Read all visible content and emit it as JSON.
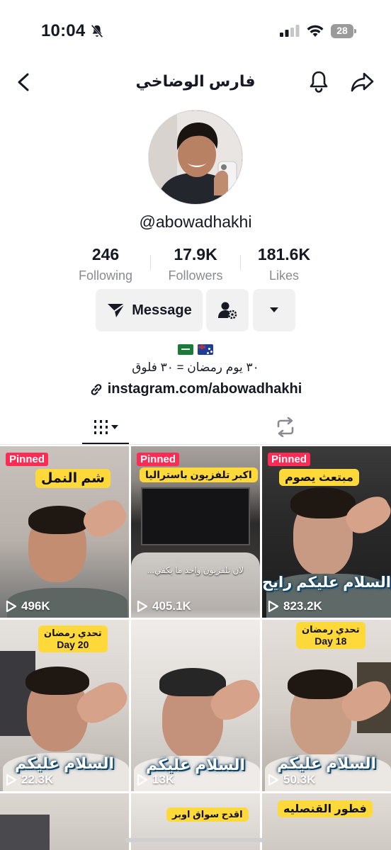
{
  "status_bar": {
    "time": "10:04",
    "battery": "28"
  },
  "header": {
    "title": "فارس الوضاخي"
  },
  "profile": {
    "username": "@abowadhakhi",
    "stats": [
      {
        "value": "246",
        "label": "Following"
      },
      {
        "value": "17.9K",
        "label": "Followers"
      },
      {
        "value": "181.6K",
        "label": "Likes"
      }
    ],
    "message_label": "Message",
    "bio_flags": [
      "saudi-flag",
      "australia-flag"
    ],
    "bio": "٣٠ يوم رمضان = ٣٠ فلوق",
    "link": "instagram.com/abowadhakhi"
  },
  "icons": {
    "back": "chevron-left-icon",
    "bell": "bell-icon",
    "share": "share-icon",
    "message": "send-icon",
    "suggest": "add-friend-gear-icon",
    "more": "triangle-down-icon",
    "link": "link-icon",
    "videos_tab": "grid-icon",
    "reposts_tab": "repost-icon",
    "play": "play-icon"
  },
  "colors": {
    "pinned_badge": "#fe2c55",
    "caption_bg": "#ffd83a",
    "button_bg": "#f1f1f2",
    "secondary_text": "#8a8b91"
  },
  "videos": [
    {
      "pinned": "Pinned",
      "caption": "شم النمل",
      "overlay": "",
      "views": "496K"
    },
    {
      "pinned": "Pinned",
      "caption": "اكبر تلفزيون باستراليا",
      "overlay": "لان تلفزيون واحد ما يكفي...",
      "views": "405.1K"
    },
    {
      "pinned": "Pinned",
      "caption": "مبتعث يصوم",
      "overlay": "السلام عليكم رايح",
      "views": "823.2K"
    },
    {
      "pinned": "",
      "caption": "تحدي رمضان",
      "caption_sub": "Day 20",
      "overlay": "السلام عليكم",
      "views": "22.3K"
    },
    {
      "pinned": "",
      "caption": "",
      "overlay": "السلام عليكم",
      "views": "13K"
    },
    {
      "pinned": "",
      "caption": "تحدي رمضان",
      "caption_sub": "Day 18",
      "overlay": "السلام عليكم",
      "views": "50.3K"
    },
    {
      "pinned": "",
      "caption": "",
      "overlay": "",
      "views": ""
    },
    {
      "pinned": "",
      "caption": "اقدح سواق اوبر",
      "overlay": "",
      "views": ""
    },
    {
      "pinned": "",
      "caption": "فطور القنصليه",
      "overlay": "",
      "views": ""
    }
  ]
}
